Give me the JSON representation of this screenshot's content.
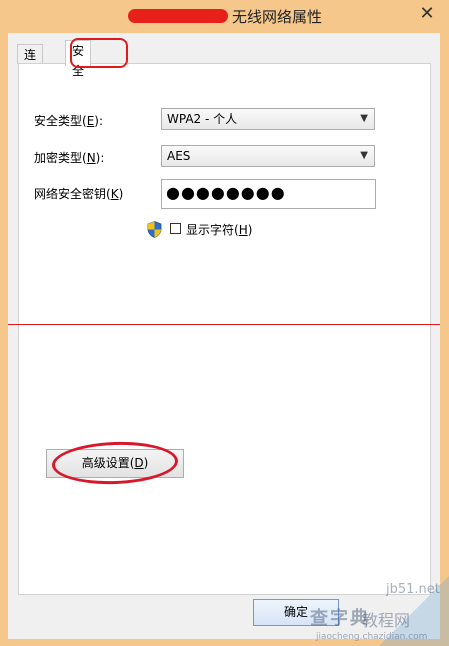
{
  "window": {
    "title": "无线网络属性",
    "close_glyph": "✕"
  },
  "tabs": [
    {
      "label": "连接",
      "active": false
    },
    {
      "label": "安全",
      "active": true
    }
  ],
  "security": {
    "security_type_label": "安全类型(",
    "security_type_key": "E",
    "security_type_suffix": "):",
    "security_type_value": "WPA2 - 个人",
    "encryption_type_label": "加密类型(",
    "encryption_type_key": "N",
    "encryption_type_suffix": "):",
    "encryption_type_value": "AES",
    "key_label": "网络安全密钥(",
    "key_key": "K",
    "key_suffix": ")",
    "key_value": "●●●●●●●●",
    "show_chars_label": "显示字符(",
    "show_chars_key": "H",
    "show_chars_suffix": ")",
    "show_chars_checked": false
  },
  "buttons": {
    "advanced_label": "高级设置(",
    "advanced_key": "D",
    "advanced_suffix": ")",
    "ok_label": "确定"
  },
  "watermark": {
    "line1": "查字典",
    "line2": "教程网",
    "line3": "jiaocheng.chazidian.com",
    "site": "jb51.net"
  },
  "colors": {
    "title_bar": "#f6c78a",
    "annotation_red": "#e01a1a",
    "ok_border": "#6f9ad8"
  },
  "icons": {
    "shield": "uac-shield-icon",
    "dropdown": "chevron-down-icon"
  }
}
